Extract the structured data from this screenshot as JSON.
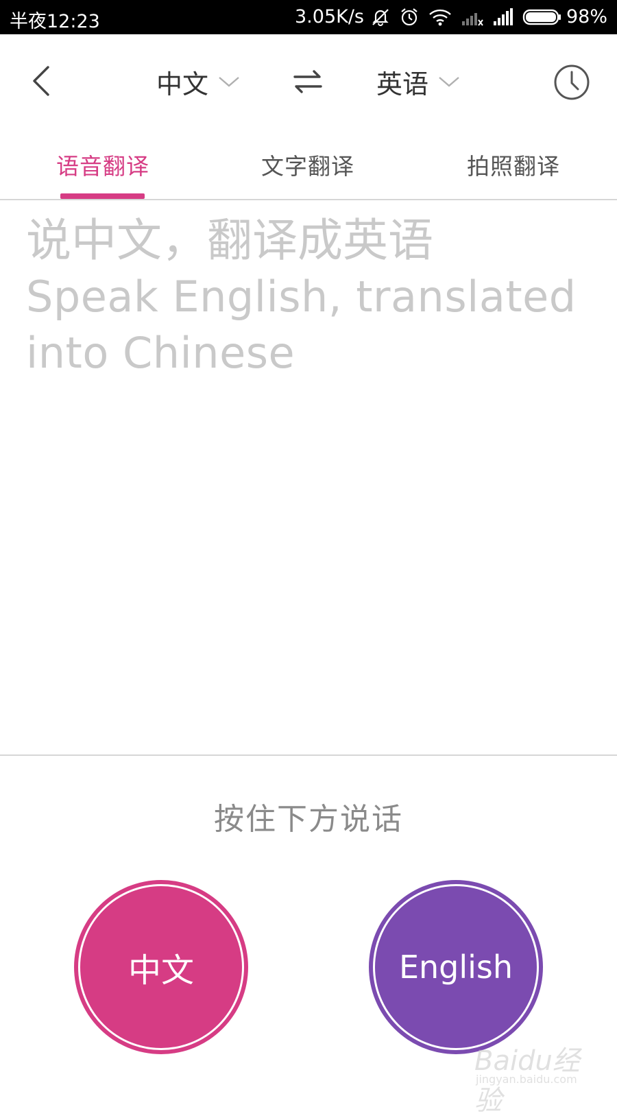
{
  "status_bar": {
    "time": "半夜12:23",
    "net_speed": "3.05K/s",
    "battery": "98%",
    "icons": [
      "mute-notification-icon",
      "alarm-icon",
      "wifi-icon",
      "signal-no-sim-icon",
      "signal-icon",
      "battery-icon"
    ]
  },
  "toolbar": {
    "source_language": "中文",
    "target_language": "英语"
  },
  "tabs": [
    {
      "label": "语音翻译",
      "active": true
    },
    {
      "label": "文字翻译",
      "active": false
    },
    {
      "label": "拍照翻译",
      "active": false
    }
  ],
  "hint": {
    "zh": "说中文，翻译成英语",
    "en": "Speak English, translated into Chinese"
  },
  "press_hint": "按住下方说话",
  "buttons": {
    "chinese": "中文",
    "english": "English"
  },
  "watermark": {
    "brand": "Baidu经验",
    "url": "jingyan.baidu.com"
  },
  "colors": {
    "accent": "#d63c84",
    "purple": "#7b4bb0",
    "hint_text": "#c9c9c9"
  }
}
